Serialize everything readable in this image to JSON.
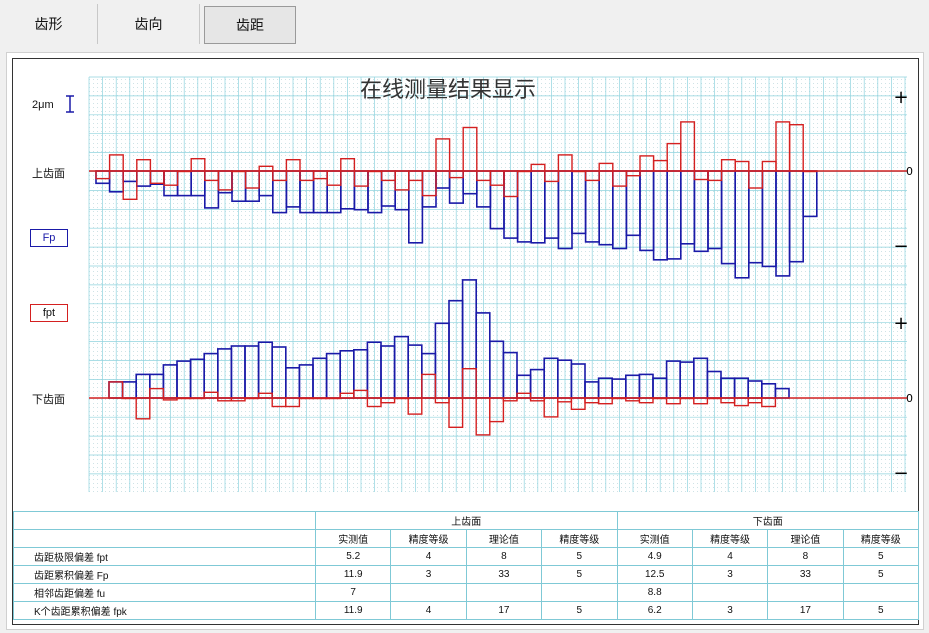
{
  "tabs": [
    {
      "label": "齿形",
      "active": false
    },
    {
      "label": "齿向",
      "active": false
    },
    {
      "label": "齿距",
      "active": true
    }
  ],
  "labels": {
    "scale": "2μm",
    "upper_flank": "上齿面",
    "lower_flank": "下齿面",
    "legend_fp": "Fp",
    "legend_fpt": "fpt",
    "axis_plus": "+",
    "axis_minus": "−",
    "axis_zero": "0"
  },
  "colors": {
    "fp": "#1a1aa8",
    "fpt": "#d42020",
    "grid": "#8fd3de",
    "title": "#333333"
  },
  "chart_data": {
    "type": "bar",
    "title": "在线测量结果显示",
    "unit": "μm",
    "scale_marker": "2μm",
    "grid": true,
    "panels": [
      {
        "name": "上齿面",
        "series": [
          {
            "name": "Fp",
            "values": [
              -1.3,
              -2.2,
              -1.1,
              -1.6,
              -1.4,
              -2.6,
              -2.6,
              -2.6,
              -3.9,
              -2.3,
              -3.2,
              -3.2,
              -2.6,
              -4.4,
              -3.8,
              -4.4,
              -4.4,
              -4.4,
              -4.0,
              -4.1,
              -4.4,
              -3.7,
              -4.1,
              -7.6,
              -3.8,
              -1.8,
              -3.4,
              -2.4,
              -3.8,
              -6.1,
              -7.1,
              -7.5,
              -7.6,
              -7.1,
              -8.2,
              -6.6,
              -7.5,
              -7.8,
              -8.2,
              -6.8,
              -8.4,
              -9.4,
              -9.3,
              -7.7,
              -8.5,
              -8.2,
              -9.8,
              -11.3,
              -9.7,
              -10.1,
              -11.1,
              -9.6,
              -4.8
            ]
          },
          {
            "name": "fpt",
            "values": [
              -0.8,
              1.7,
              -3.0,
              1.2,
              -1.3,
              -1.5,
              0.0,
              1.3,
              -1.0,
              -2.0,
              0.0,
              -1.8,
              0.5,
              -1.0,
              1.2,
              -1.0,
              -0.8,
              -1.5,
              1.3,
              -1.6,
              0.0,
              -1.0,
              -2.0,
              -1.0,
              -2.6,
              3.4,
              -0.7,
              4.6,
              -1.0,
              -1.5,
              -2.7,
              0.0,
              0.7,
              -1.1,
              1.7,
              0.0,
              -1.0,
              0.8,
              -1.6,
              -0.5,
              1.6,
              1.1,
              2.9,
              5.2,
              -0.9,
              -1.0,
              1.2,
              1.0,
              -1.8,
              1.0,
              5.2,
              4.9,
              0.0
            ]
          }
        ]
      },
      {
        "name": "下齿面",
        "series": [
          {
            "name": "Fp",
            "values": [
              1.7,
              1.7,
              2.5,
              2.5,
              3.5,
              3.9,
              4.1,
              4.7,
              5.2,
              5.5,
              5.5,
              5.9,
              5.4,
              3.2,
              3.5,
              4.2,
              4.7,
              5.0,
              5.1,
              5.9,
              5.5,
              6.5,
              5.6,
              4.7,
              7.9,
              10.3,
              12.5,
              9.0,
              6.0,
              4.8,
              2.4,
              3.0,
              4.2,
              4.0,
              3.6,
              1.7,
              2.1,
              2.0,
              2.4,
              2.5,
              2.1,
              3.9,
              3.8,
              4.2,
              2.8,
              2.1,
              2.1,
              1.8,
              1.5,
              1.0
            ]
          },
          {
            "name": "fpt",
            "values": [
              1.7,
              0.0,
              -2.2,
              1.0,
              -0.2,
              0.0,
              0.0,
              0.6,
              -0.3,
              -0.3,
              0.0,
              0.5,
              -0.9,
              -0.9,
              0.0,
              0.0,
              0.0,
              0.5,
              0.8,
              -0.9,
              -0.5,
              0.0,
              -1.7,
              2.5,
              -0.5,
              -3.1,
              3.1,
              -3.9,
              -2.5,
              -0.3,
              0.5,
              -0.3,
              -2.0,
              -0.4,
              -1.2,
              -0.5,
              -0.6,
              0.0,
              -0.3,
              -0.5,
              0.0,
              -0.6,
              0.0,
              -0.6,
              0.0,
              -0.5,
              -0.8,
              -0.5,
              -0.9
            ]
          }
        ]
      }
    ]
  },
  "table": {
    "groups": [
      "上齿面",
      "下齿面"
    ],
    "columns": [
      "实测值",
      "精度等级",
      "理论值",
      "精度等级",
      "实测值",
      "精度等级",
      "理论值",
      "精度等级"
    ],
    "rows": [
      {
        "label": "齿距极限偏差 fpt",
        "cells": [
          "5.2",
          "4",
          "8",
          "5",
          "4.9",
          "4",
          "8",
          "5"
        ]
      },
      {
        "label": "齿距累积偏差 Fp",
        "cells": [
          "11.9",
          "3",
          "33",
          "5",
          "12.5",
          "3",
          "33",
          "5"
        ]
      },
      {
        "label": "相邻齿距偏差 fu",
        "cells": [
          "7",
          "",
          "",
          "",
          "8.8",
          "",
          "",
          ""
        ]
      },
      {
        "label": "K个齿距累积偏差 fpk",
        "cells": [
          "11.9",
          "4",
          "17",
          "5",
          "6.2",
          "3",
          "17",
          "5"
        ]
      }
    ]
  }
}
